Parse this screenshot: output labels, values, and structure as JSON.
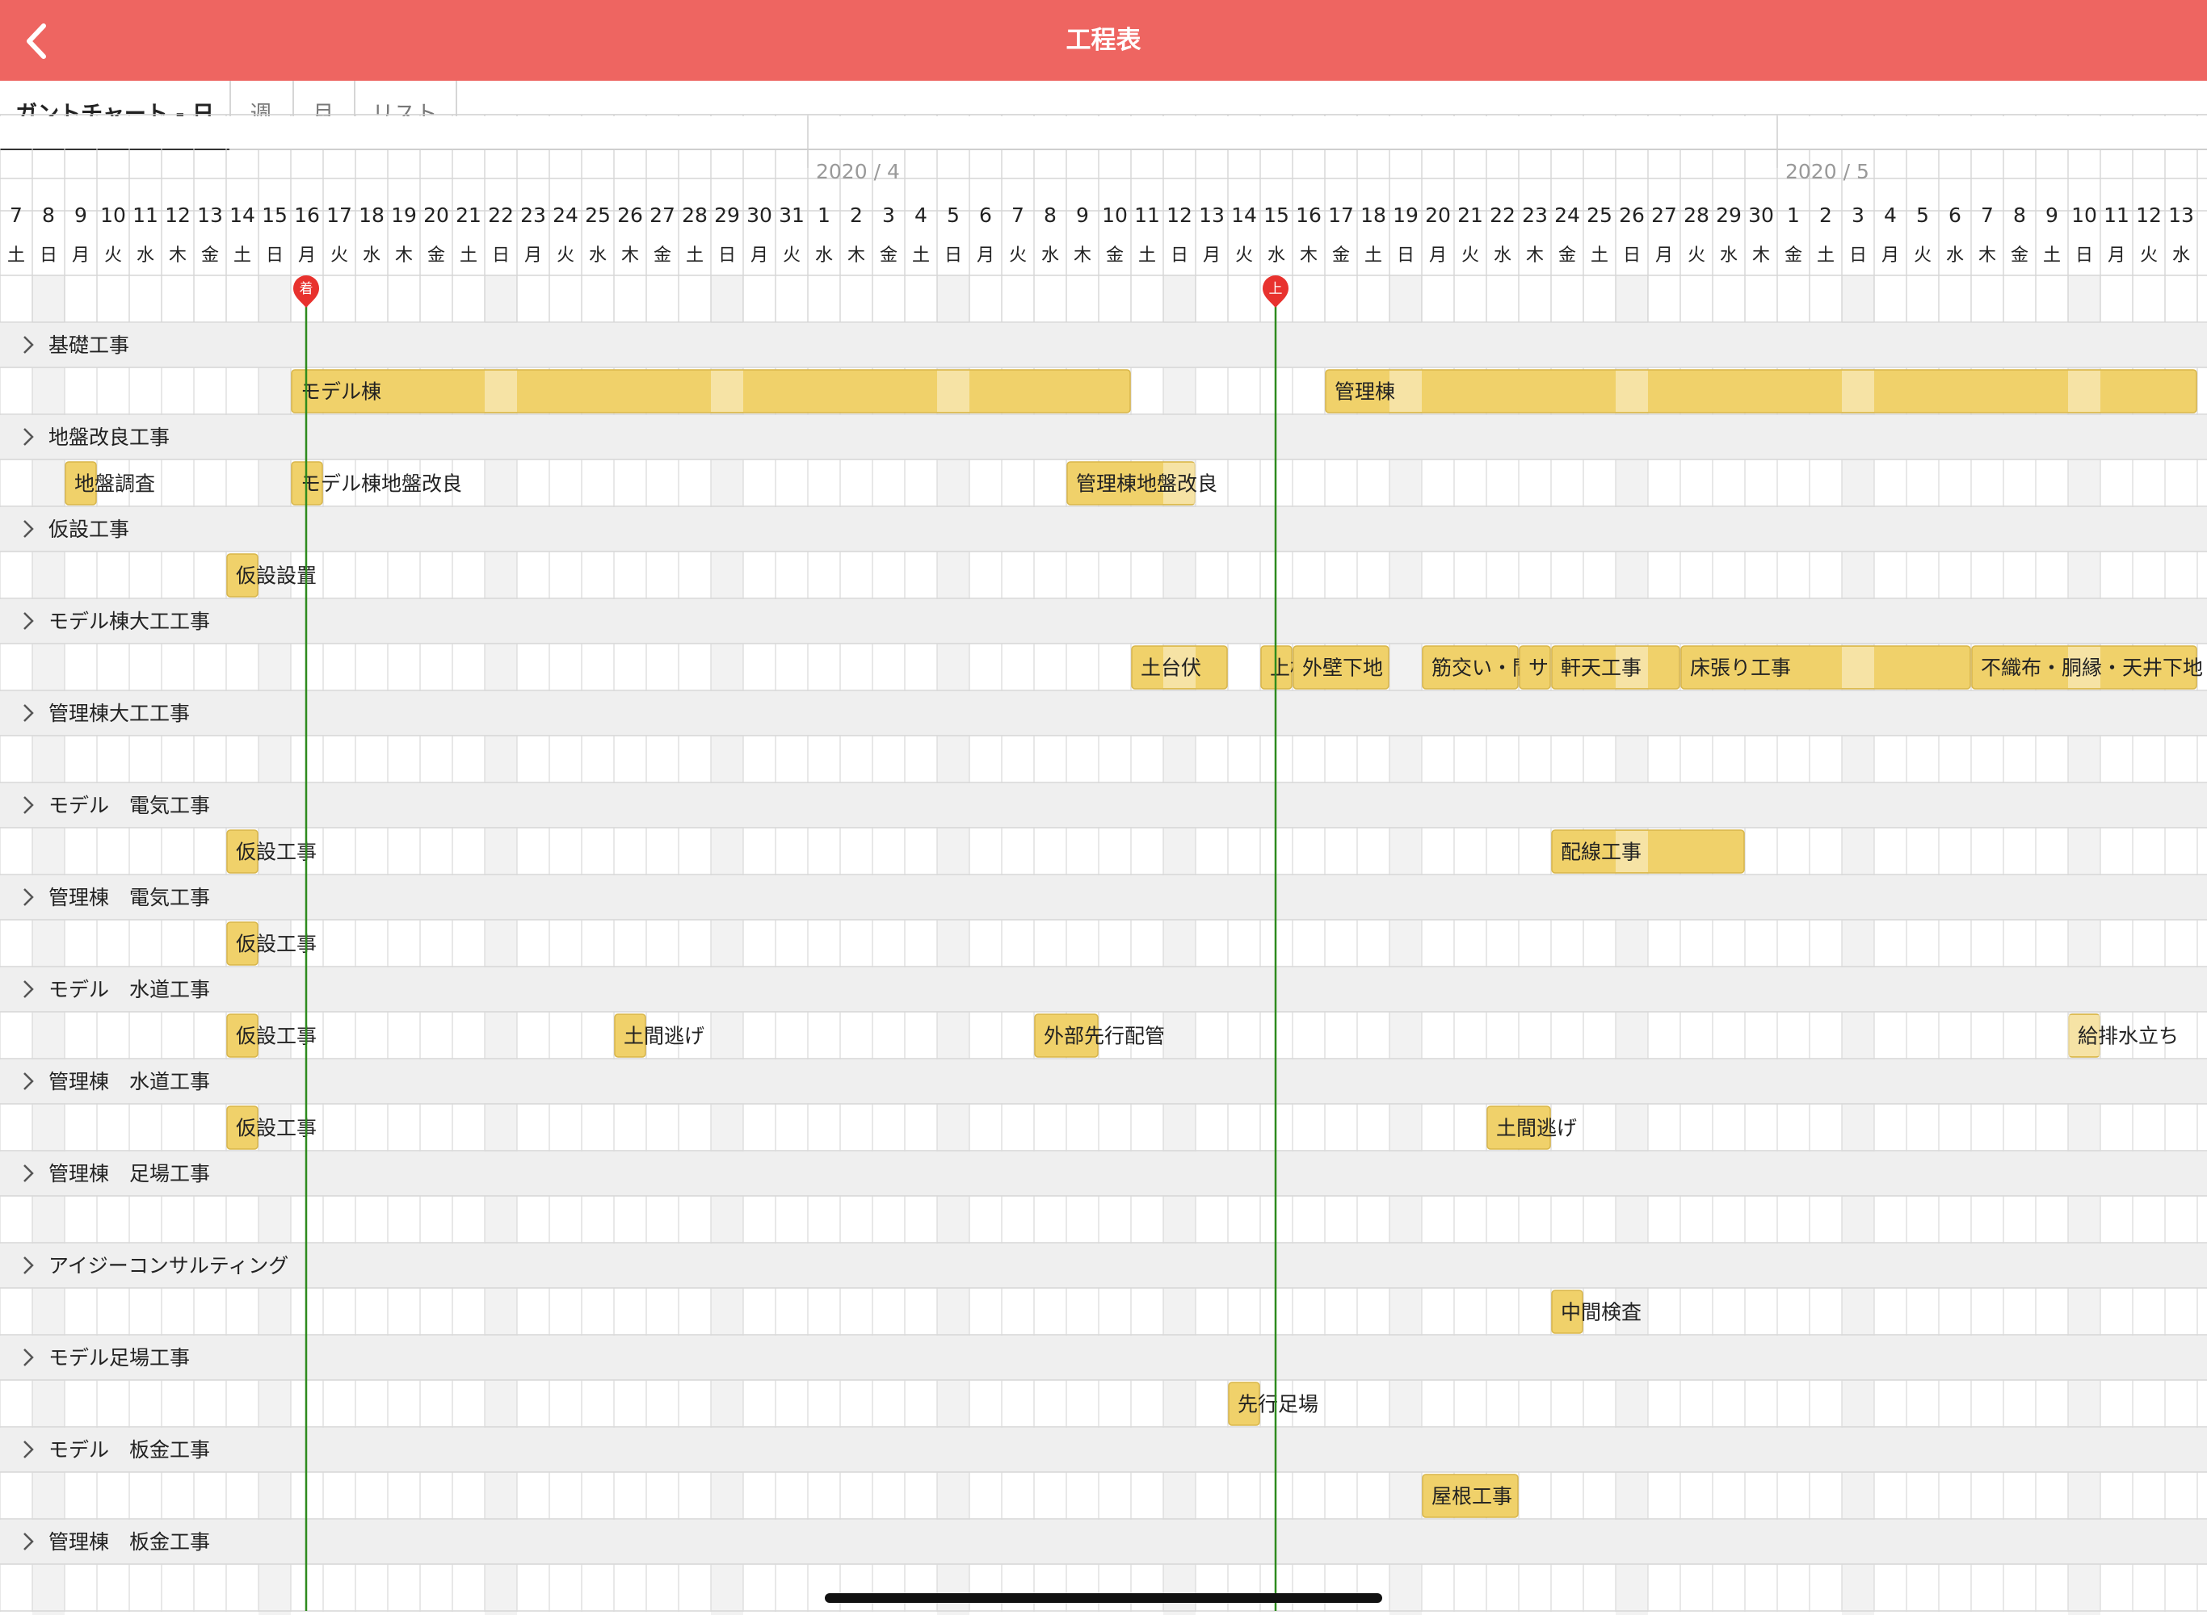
{
  "header": {
    "title": "工程表",
    "back_icon": "chevron-left-icon"
  },
  "tabs": [
    {
      "label": "ガントチャート - 日",
      "active": true
    },
    {
      "label": "週",
      "active": false
    },
    {
      "label": "月",
      "active": false
    },
    {
      "label": "リスト",
      "active": false
    }
  ],
  "colors": {
    "header": "#ee6561",
    "bar": "#f0d16a",
    "bar_border": "#d8b64a",
    "today_line": "#2e8b1e",
    "weekend": "#f2f2f2",
    "section_bg": "#efefef",
    "marker": "#e8322e"
  },
  "calendar": {
    "first_date": "2020-03-07",
    "month_labels": [
      {
        "label": "2020 / 4",
        "date": "2020-04-01"
      },
      {
        "label": "2020 / 5",
        "date": "2020-05-01"
      }
    ],
    "day_numbers": [
      "7",
      "8",
      "9",
      "10",
      "11",
      "12",
      "13",
      "14",
      "15",
      "16",
      "17",
      "18",
      "19",
      "20",
      "21",
      "22",
      "23",
      "24",
      "25",
      "26",
      "27",
      "28",
      "29",
      "30",
      "31",
      "1",
      "2",
      "3",
      "4",
      "5",
      "6",
      "7",
      "8",
      "9",
      "10",
      "11",
      "12",
      "13",
      "14",
      "15",
      "16",
      "17",
      "18",
      "19",
      "20",
      "21",
      "22",
      "23",
      "24",
      "25",
      "26",
      "27",
      "28",
      "29",
      "30",
      "1",
      "2",
      "3",
      "4",
      "5",
      "6",
      "7",
      "8",
      "9",
      "10",
      "11",
      "12",
      "13"
    ],
    "weekday_labels": [
      "土",
      "日",
      "月",
      "火",
      "水",
      "木",
      "金",
      "土",
      "日",
      "月",
      "火",
      "水",
      "木",
      "金",
      "土",
      "日",
      "月",
      "火",
      "水",
      "木",
      "金",
      "土",
      "日",
      "月",
      "火",
      "水",
      "木",
      "金",
      "土",
      "日",
      "月",
      "火",
      "水",
      "木",
      "金",
      "土",
      "日",
      "月",
      "火",
      "水",
      "木",
      "金",
      "土",
      "日",
      "月",
      "火",
      "水",
      "木",
      "金",
      "土",
      "日",
      "月",
      "火",
      "水",
      "木",
      "金",
      "土",
      "日",
      "月",
      "火",
      "水",
      "木",
      "金",
      "土",
      "日",
      "月",
      "火",
      "水"
    ],
    "shaded_dates": [
      "2020-03-08",
      "2020-03-15",
      "2020-03-22",
      "2020-03-29",
      "2020-04-05",
      "2020-04-12",
      "2020-04-19",
      "2020-04-26",
      "2020-05-03",
      "2020-05-10"
    ]
  },
  "milestones": [
    {
      "label": "着",
      "date": "2020-03-16"
    },
    {
      "label": "上",
      "date": "2020-04-15"
    }
  ],
  "sections": [
    {
      "name": "基礎工事",
      "tasks": [
        {
          "label": "モデル棟",
          "start": "2020-03-16",
          "end": "2020-04-10"
        },
        {
          "label": "管理棟",
          "start": "2020-04-17",
          "end": "2020-05-13"
        }
      ]
    },
    {
      "name": "地盤改良工事",
      "tasks": [
        {
          "label": "地盤調査",
          "start": "2020-03-09",
          "end": "2020-03-09"
        },
        {
          "label": "モデル棟地盤改良",
          "start": "2020-03-16",
          "end": "2020-03-16"
        },
        {
          "label": "管理棟地盤改良",
          "start": "2020-04-09",
          "end": "2020-04-12"
        }
      ]
    },
    {
      "name": "仮設工事",
      "tasks": [
        {
          "label": "仮設設置",
          "start": "2020-03-14",
          "end": "2020-03-14"
        }
      ]
    },
    {
      "name": "モデル棟大工工事",
      "tasks": [
        {
          "label": "土台伏",
          "start": "2020-04-11",
          "end": "2020-04-13"
        },
        {
          "label": "上棟",
          "start": "2020-04-15",
          "end": "2020-04-15"
        },
        {
          "label": "外壁下地",
          "start": "2020-04-16",
          "end": "2020-04-18"
        },
        {
          "label": "筋交い・間",
          "start": "2020-04-20",
          "end": "2020-04-22"
        },
        {
          "label": "サ",
          "start": "2020-04-23",
          "end": "2020-04-23"
        },
        {
          "label": "軒天工事",
          "start": "2020-04-24",
          "end": "2020-04-27"
        },
        {
          "label": "床張り工事",
          "start": "2020-04-28",
          "end": "2020-05-06"
        },
        {
          "label": "不織布・胴縁・天井下地",
          "start": "2020-05-07",
          "end": "2020-05-13"
        }
      ]
    },
    {
      "name": "管理棟大工工事",
      "tasks": []
    },
    {
      "name": "モデル　電気工事",
      "tasks": [
        {
          "label": "仮設工事",
          "start": "2020-03-14",
          "end": "2020-03-14"
        },
        {
          "label": "配線工事",
          "start": "2020-04-24",
          "end": "2020-04-29"
        }
      ]
    },
    {
      "name": "管理棟　電気工事",
      "tasks": [
        {
          "label": "仮設工事",
          "start": "2020-03-14",
          "end": "2020-03-14"
        }
      ]
    },
    {
      "name": "モデル　水道工事",
      "tasks": [
        {
          "label": "仮設工事",
          "start": "2020-03-14",
          "end": "2020-03-14"
        },
        {
          "label": "土間逃げ",
          "start": "2020-03-26",
          "end": "2020-03-26"
        },
        {
          "label": "外部先行配管",
          "start": "2020-04-08",
          "end": "2020-04-09"
        },
        {
          "label": "給排水立ち",
          "start": "2020-05-10",
          "end": "2020-05-10"
        }
      ]
    },
    {
      "name": "管理棟　水道工事",
      "tasks": [
        {
          "label": "仮設工事",
          "start": "2020-03-14",
          "end": "2020-03-14"
        },
        {
          "label": "土間逃げ",
          "start": "2020-04-22",
          "end": "2020-04-23"
        }
      ]
    },
    {
      "name": "管理棟　足場工事",
      "tasks": []
    },
    {
      "name": "アイジーコンサルティング",
      "tasks": [
        {
          "label": "中間検査",
          "start": "2020-04-24",
          "end": "2020-04-24"
        }
      ]
    },
    {
      "name": "モデル足場工事",
      "tasks": [
        {
          "label": "先行足場",
          "start": "2020-04-14",
          "end": "2020-04-14"
        }
      ]
    },
    {
      "name": "モデル　板金工事",
      "tasks": [
        {
          "label": "屋根工事",
          "start": "2020-04-20",
          "end": "2020-04-22"
        }
      ]
    },
    {
      "name": "管理棟　板金工事",
      "tasks": []
    }
  ]
}
